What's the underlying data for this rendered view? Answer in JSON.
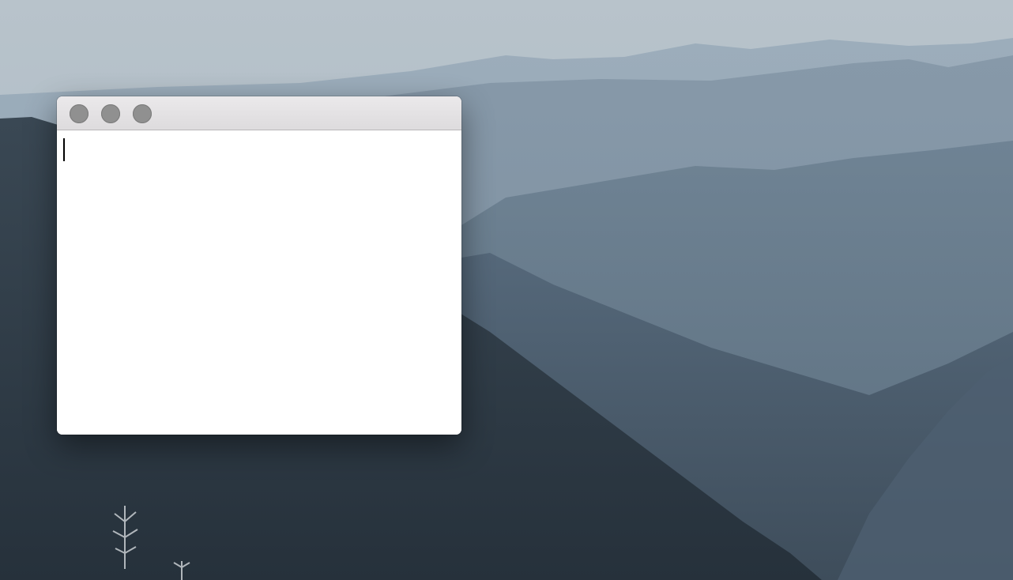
{
  "wallpaper": {
    "description_icon": "mountain-landscape-wallpaper",
    "colors": {
      "sky": "#b3c0c9",
      "haze": "#8fa2b2",
      "ridge_far": "#7f93a4",
      "ridge_mid": "#5f7384",
      "forest": "#2e3a46"
    }
  },
  "window": {
    "titlebar": {
      "buttons": [
        {
          "id": "close",
          "icon": "close-dot-icon",
          "color": "#909090"
        },
        {
          "id": "minimize",
          "icon": "minimize-dot-icon",
          "color": "#909090"
        },
        {
          "id": "maximize",
          "icon": "maximize-dot-icon",
          "color": "#909090"
        }
      ]
    },
    "editor": {
      "value": ""
    }
  }
}
